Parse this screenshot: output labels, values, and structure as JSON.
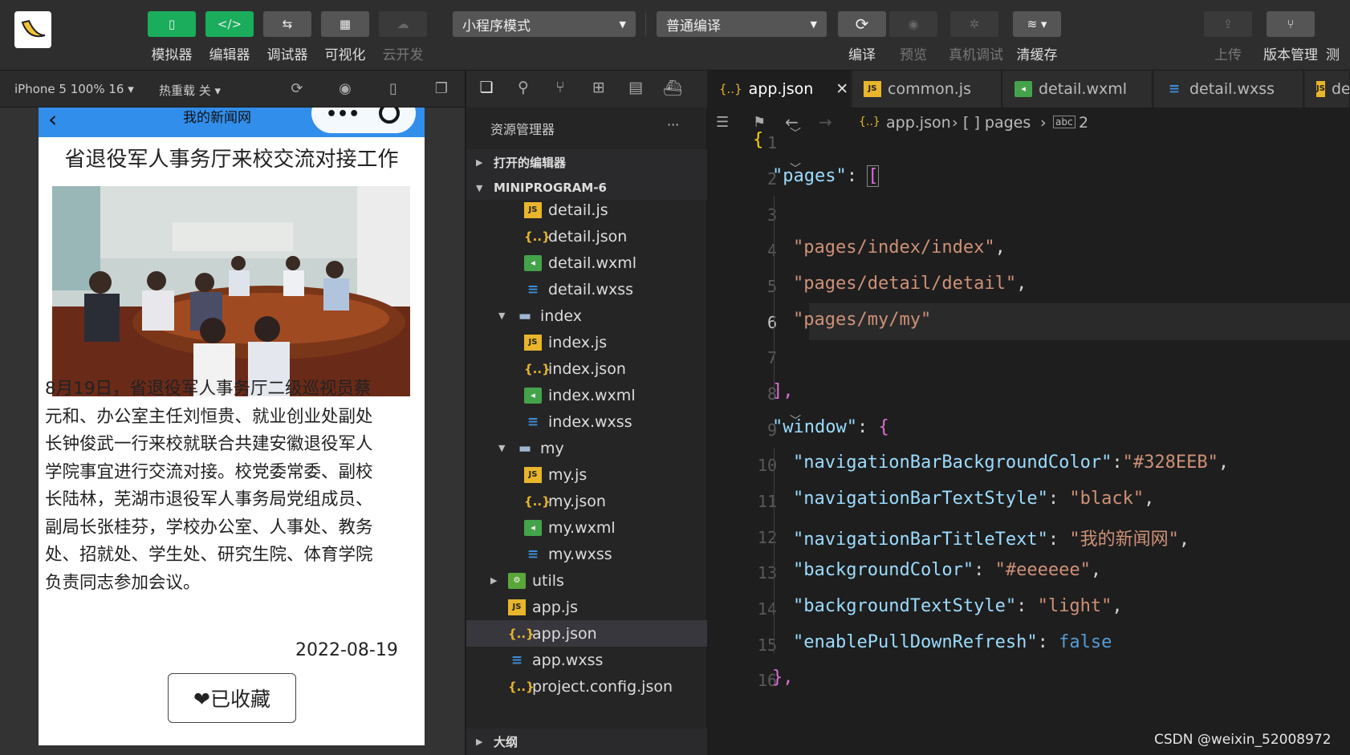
{
  "toolbar": {
    "buttons": [
      {
        "label": "模拟器"
      },
      {
        "label": "编辑器"
      },
      {
        "label": "调试器"
      },
      {
        "label": "可视化"
      },
      {
        "label": "云开发"
      }
    ],
    "mode_select": "小程序模式",
    "compile_select": "普通编译",
    "right_buttons": [
      {
        "label": "编译"
      },
      {
        "label": "预览"
      },
      {
        "label": "真机调试"
      },
      {
        "label": "清缓存"
      },
      {
        "label": "上传"
      },
      {
        "label": "版本管理"
      },
      {
        "label": "测"
      }
    ]
  },
  "simbar": {
    "device": "iPhone 5 100% 16 ▾",
    "hotreload": "热重载 关 ▾"
  },
  "phone": {
    "nav_title": "我的新闻网",
    "article_title": "省退役军人事务厅来校交流对接工作",
    "body_lines": [
      "8月19日，省退役军人事务厅二级巡视员蔡",
      "元和、办公室主任刘恒贵、就业创业处副处",
      "长钟俊武一行来校就联合共建安徽退役军人",
      "学院事宜进行交流对接。校党委常委、副校",
      "长陆林，芜湖市退役军人事务局党组成员、",
      "副局长张桂芬，学校办公室、人事处、教务",
      "处、招就处、学生处、研究生院、体育学院",
      "负责同志参加会议。"
    ],
    "date": "2022-08-19",
    "fav_button": "❤已收藏"
  },
  "explorer": {
    "title": "资源管理器",
    "more": "···",
    "open_editors": "打开的编辑器",
    "project": "MINIPROGRAM-6",
    "outline": "大纲",
    "files": [
      {
        "name": "detail.js",
        "type": "js",
        "indent": 72
      },
      {
        "name": "detail.json",
        "type": "json",
        "indent": 72
      },
      {
        "name": "detail.wxml",
        "type": "wxml",
        "indent": 72
      },
      {
        "name": "detail.wxss",
        "type": "wxss",
        "indent": 72
      },
      {
        "name": "index",
        "type": "folder",
        "indent": 40,
        "arrow": "▼"
      },
      {
        "name": "index.js",
        "type": "js",
        "indent": 72
      },
      {
        "name": "index.json",
        "type": "json",
        "indent": 72
      },
      {
        "name": "index.wxml",
        "type": "wxml",
        "indent": 72
      },
      {
        "name": "index.wxss",
        "type": "wxss",
        "indent": 72
      },
      {
        "name": "my",
        "type": "folder",
        "indent": 40,
        "arrow": "▼"
      },
      {
        "name": "my.js",
        "type": "js",
        "indent": 72
      },
      {
        "name": "my.json",
        "type": "json",
        "indent": 72
      },
      {
        "name": "my.wxml",
        "type": "wxml",
        "indent": 72
      },
      {
        "name": "my.wxss",
        "type": "wxss",
        "indent": 72
      },
      {
        "name": "utils",
        "type": "utils",
        "indent": 30,
        "arrow": "▶"
      },
      {
        "name": "app.js",
        "type": "js",
        "indent": 52
      },
      {
        "name": "app.json",
        "type": "json",
        "indent": 52,
        "selected": true
      },
      {
        "name": "app.wxss",
        "type": "wxss",
        "indent": 52
      },
      {
        "name": "project.config.json",
        "type": "json",
        "indent": 52
      }
    ]
  },
  "editor": {
    "tabs": [
      {
        "label": "app.json",
        "icon": "{..}",
        "active": true,
        "close": "✕"
      },
      {
        "label": "common.js",
        "icon": "JS"
      },
      {
        "label": "detail.wxml",
        "icon": "wxml"
      },
      {
        "label": "detail.wxss",
        "icon": "wxss"
      },
      {
        "label": "de",
        "icon": "JS"
      }
    ],
    "breadcrumb": {
      "file": "app.json",
      "seg1": "[ ] pages",
      "seg2": "2"
    },
    "line_numbers": [
      "1",
      "2",
      "3",
      "4",
      "5",
      "6",
      "7",
      "8",
      "9",
      "10",
      "11",
      "12",
      "13",
      "14",
      "15",
      "16"
    ],
    "current_line": "6",
    "code": {
      "l1": "{",
      "l2_key": "\"pages\"",
      "l2_colon": ": ",
      "l2_br": "[",
      "l4": "\"pages/index/index\"",
      "l5": "\"pages/detail/detail\"",
      "l6": "\"pages/my/my\"",
      "l8": "],",
      "l9_key": "\"window\"",
      "l9_colon": ": ",
      "l9_br": "{",
      "l10_key": "\"navigationBarBackgroundColor\"",
      "l10_val": "\"#328EEB\"",
      "l11_key": "\"navigationBarTextStyle\"",
      "l11_val": "\"black\"",
      "l12_key": "\"navigationBarTitleText\"",
      "l12_val": "\"我的新闻网\"",
      "l13_key": "\"backgroundColor\"",
      "l13_val": "\"#eeeeee\"",
      "l14_key": "\"backgroundTextStyle\"",
      "l14_val": "\"light\"",
      "l15_key": "\"enablePullDownRefresh\"",
      "l15_val": "false",
      "l16": "},"
    }
  },
  "watermark": "CSDN @weixin_52008972",
  "colors": {
    "nav": "#328EEB",
    "green": "#1aad5c"
  }
}
